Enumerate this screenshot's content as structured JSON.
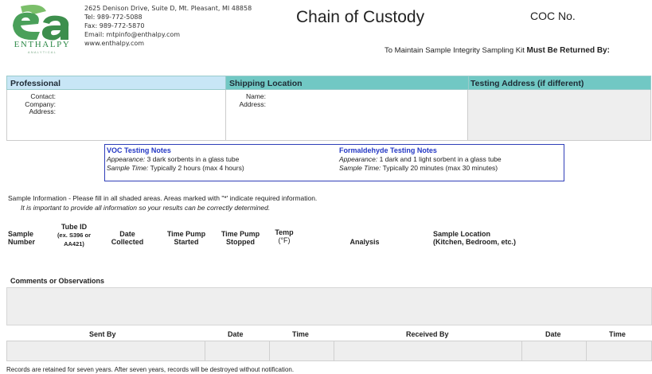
{
  "header": {
    "logo_text": "ENTHALPY",
    "logo_subtext": "ANALYTICAL",
    "address_lines": [
      "2625 Denison Drive, Suite D, Mt. Pleasant, MI 48858",
      "Tel: 989-772-5088",
      "Fax: 989-772-5870",
      "Email: mtpinfo@enthalpy.com",
      "www.enthalpy.com"
    ],
    "title": "Chain of Custody",
    "coc_label": "COC No.",
    "return_prefix": "To Maintain Sample Integrity Sampling Kit",
    "return_bold": "Must Be Returned By:"
  },
  "sections": {
    "professional": {
      "heading": "Professional",
      "fields": [
        "Contact:",
        "Company:",
        "Address:"
      ]
    },
    "shipping": {
      "heading": "Shipping Location",
      "fields": [
        "Name:",
        "Address:"
      ]
    },
    "testing": {
      "heading": "Testing Address (if different)"
    }
  },
  "notes": {
    "voc": {
      "heading": "VOC Testing Notes",
      "appearance_label": "Appearance:",
      "appearance_text": " 3 dark sorbents in a glass tube",
      "time_label": "Sample Time:",
      "time_text": " Typically 2 hours (max 4 hours)"
    },
    "formaldehyde": {
      "heading": "Formaldehyde Testing Notes",
      "appearance_label": "Appearance:",
      "appearance_text": " 1 dark and 1 light sorbent in a glass tube",
      "time_label": "Sample Time:",
      "time_text": " Typically 20 minutes (max 30 minutes)"
    }
  },
  "sample_info": {
    "line1": "Sample Information - Please fill in all shaded areas.  Areas marked with \"*' indicate required information.",
    "line2": "It is important to provide all information so your results can be correctly determined."
  },
  "columns": {
    "sample_number": [
      "Sample",
      "Number"
    ],
    "tube_id": [
      "Tube ID",
      "(ex. S396 or",
      "AA421)"
    ],
    "date_collected": [
      "Date",
      "Collected"
    ],
    "time_started": [
      "Time Pump",
      "Started"
    ],
    "time_stopped": [
      "Time Pump",
      "Stopped"
    ],
    "temp": [
      "Temp",
      "(°F)"
    ],
    "analysis": "Analysis",
    "sample_location": [
      "Sample Location",
      "(Kitchen, Bedroom, etc.)"
    ]
  },
  "comments_label": "Comments or Observations",
  "footer_table": {
    "sent_by": "Sent By",
    "date1": "Date",
    "time1": "Time",
    "received_by": "Received By",
    "date2": "Date",
    "time2": "Time"
  },
  "footer_note": "Records are retained for seven years.  After seven years, records will be destroyed without notification.",
  "colors": {
    "logo_green": "#2f8a4a",
    "professional_header": "#c8e6f6",
    "shipping_header": "#71c8c4",
    "notes_heading": "#2438c4",
    "shaded_field": "#eeeeee"
  }
}
